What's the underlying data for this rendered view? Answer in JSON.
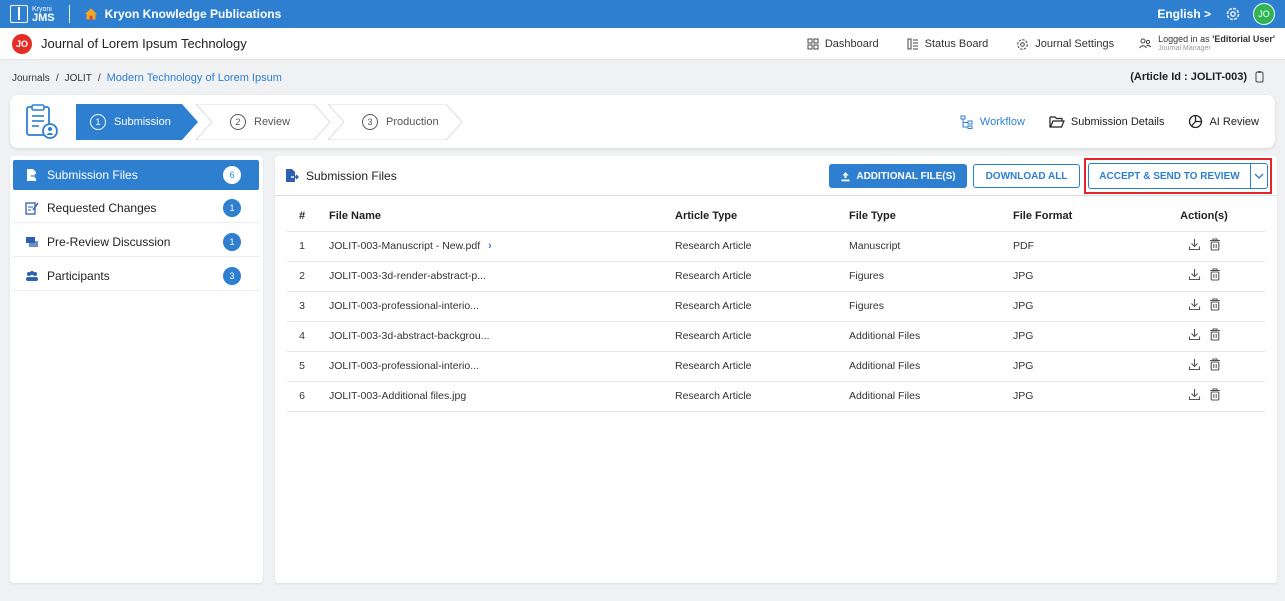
{
  "topbar": {
    "logo_small": "Kryoni",
    "logo_big": "JMS",
    "publisher": "Kryon Knowledge Publications",
    "language": "English >",
    "avatar": "JO"
  },
  "journal_bar": {
    "badge": "JO",
    "title": "Journal of Lorem Ipsum Technology",
    "nav": [
      "Dashboard",
      "Status Board",
      "Journal Settings"
    ],
    "logged_in_prefix": "Logged in as ",
    "logged_in_user": "'Editorial User'",
    "logged_in_role": "Journal Manager"
  },
  "breadcrumb": {
    "items": [
      "Journals",
      "JOLIT",
      "Modern Technology of Lorem Ipsum"
    ],
    "separator": "/"
  },
  "article_id": "(Article Id : JOLIT-003)",
  "stepper": {
    "steps": [
      {
        "num": "1",
        "label": "Submission"
      },
      {
        "num": "2",
        "label": "Review"
      },
      {
        "num": "3",
        "label": "Production"
      }
    ],
    "right_links": [
      "Workflow",
      "Submission Details",
      "AI Review"
    ]
  },
  "sidebar": {
    "items": [
      {
        "label": "Submission Files",
        "count": "6"
      },
      {
        "label": "Requested Changes",
        "count": "1"
      },
      {
        "label": "Pre-Review Discussion",
        "count": "1"
      },
      {
        "label": "Participants",
        "count": "3"
      }
    ]
  },
  "main": {
    "title": "Submission Files",
    "additional_files_label": "ADDITIONAL FILE(S)",
    "download_all_label": "DOWNLOAD ALL",
    "accept_label": "ACCEPT & SEND TO REVIEW"
  },
  "table": {
    "headers": [
      "#",
      "File Name",
      "Article Type",
      "File Type",
      "File Format",
      "Action(s)"
    ],
    "rows": [
      {
        "num": "1",
        "name": "JOLIT-003-Manuscript - New.pdf",
        "article_type": "Research Article",
        "file_type": "Manuscript",
        "format": "PDF"
      },
      {
        "num": "2",
        "name": "JOLIT-003-3d-render-abstract-p...",
        "article_type": "Research Article",
        "file_type": "Figures",
        "format": "JPG"
      },
      {
        "num": "3",
        "name": "JOLIT-003-professional-interio...",
        "article_type": "Research Article",
        "file_type": "Figures",
        "format": "JPG"
      },
      {
        "num": "4",
        "name": "JOLIT-003-3d-abstract-backgrou...",
        "article_type": "Research Article",
        "file_type": "Additional Files",
        "format": "JPG"
      },
      {
        "num": "5",
        "name": "JOLIT-003-professional-interio...",
        "article_type": "Research Article",
        "file_type": "Additional Files",
        "format": "JPG"
      },
      {
        "num": "6",
        "name": "JOLIT-003-Additional files.jpg",
        "article_type": "Research Article",
        "file_type": "Additional Files",
        "format": "JPG"
      }
    ]
  },
  "colors": {
    "primary": "#2f7fd1",
    "highlight": "#e3262a",
    "jo_badge": "#e52d27",
    "avatar": "#2fb553"
  }
}
